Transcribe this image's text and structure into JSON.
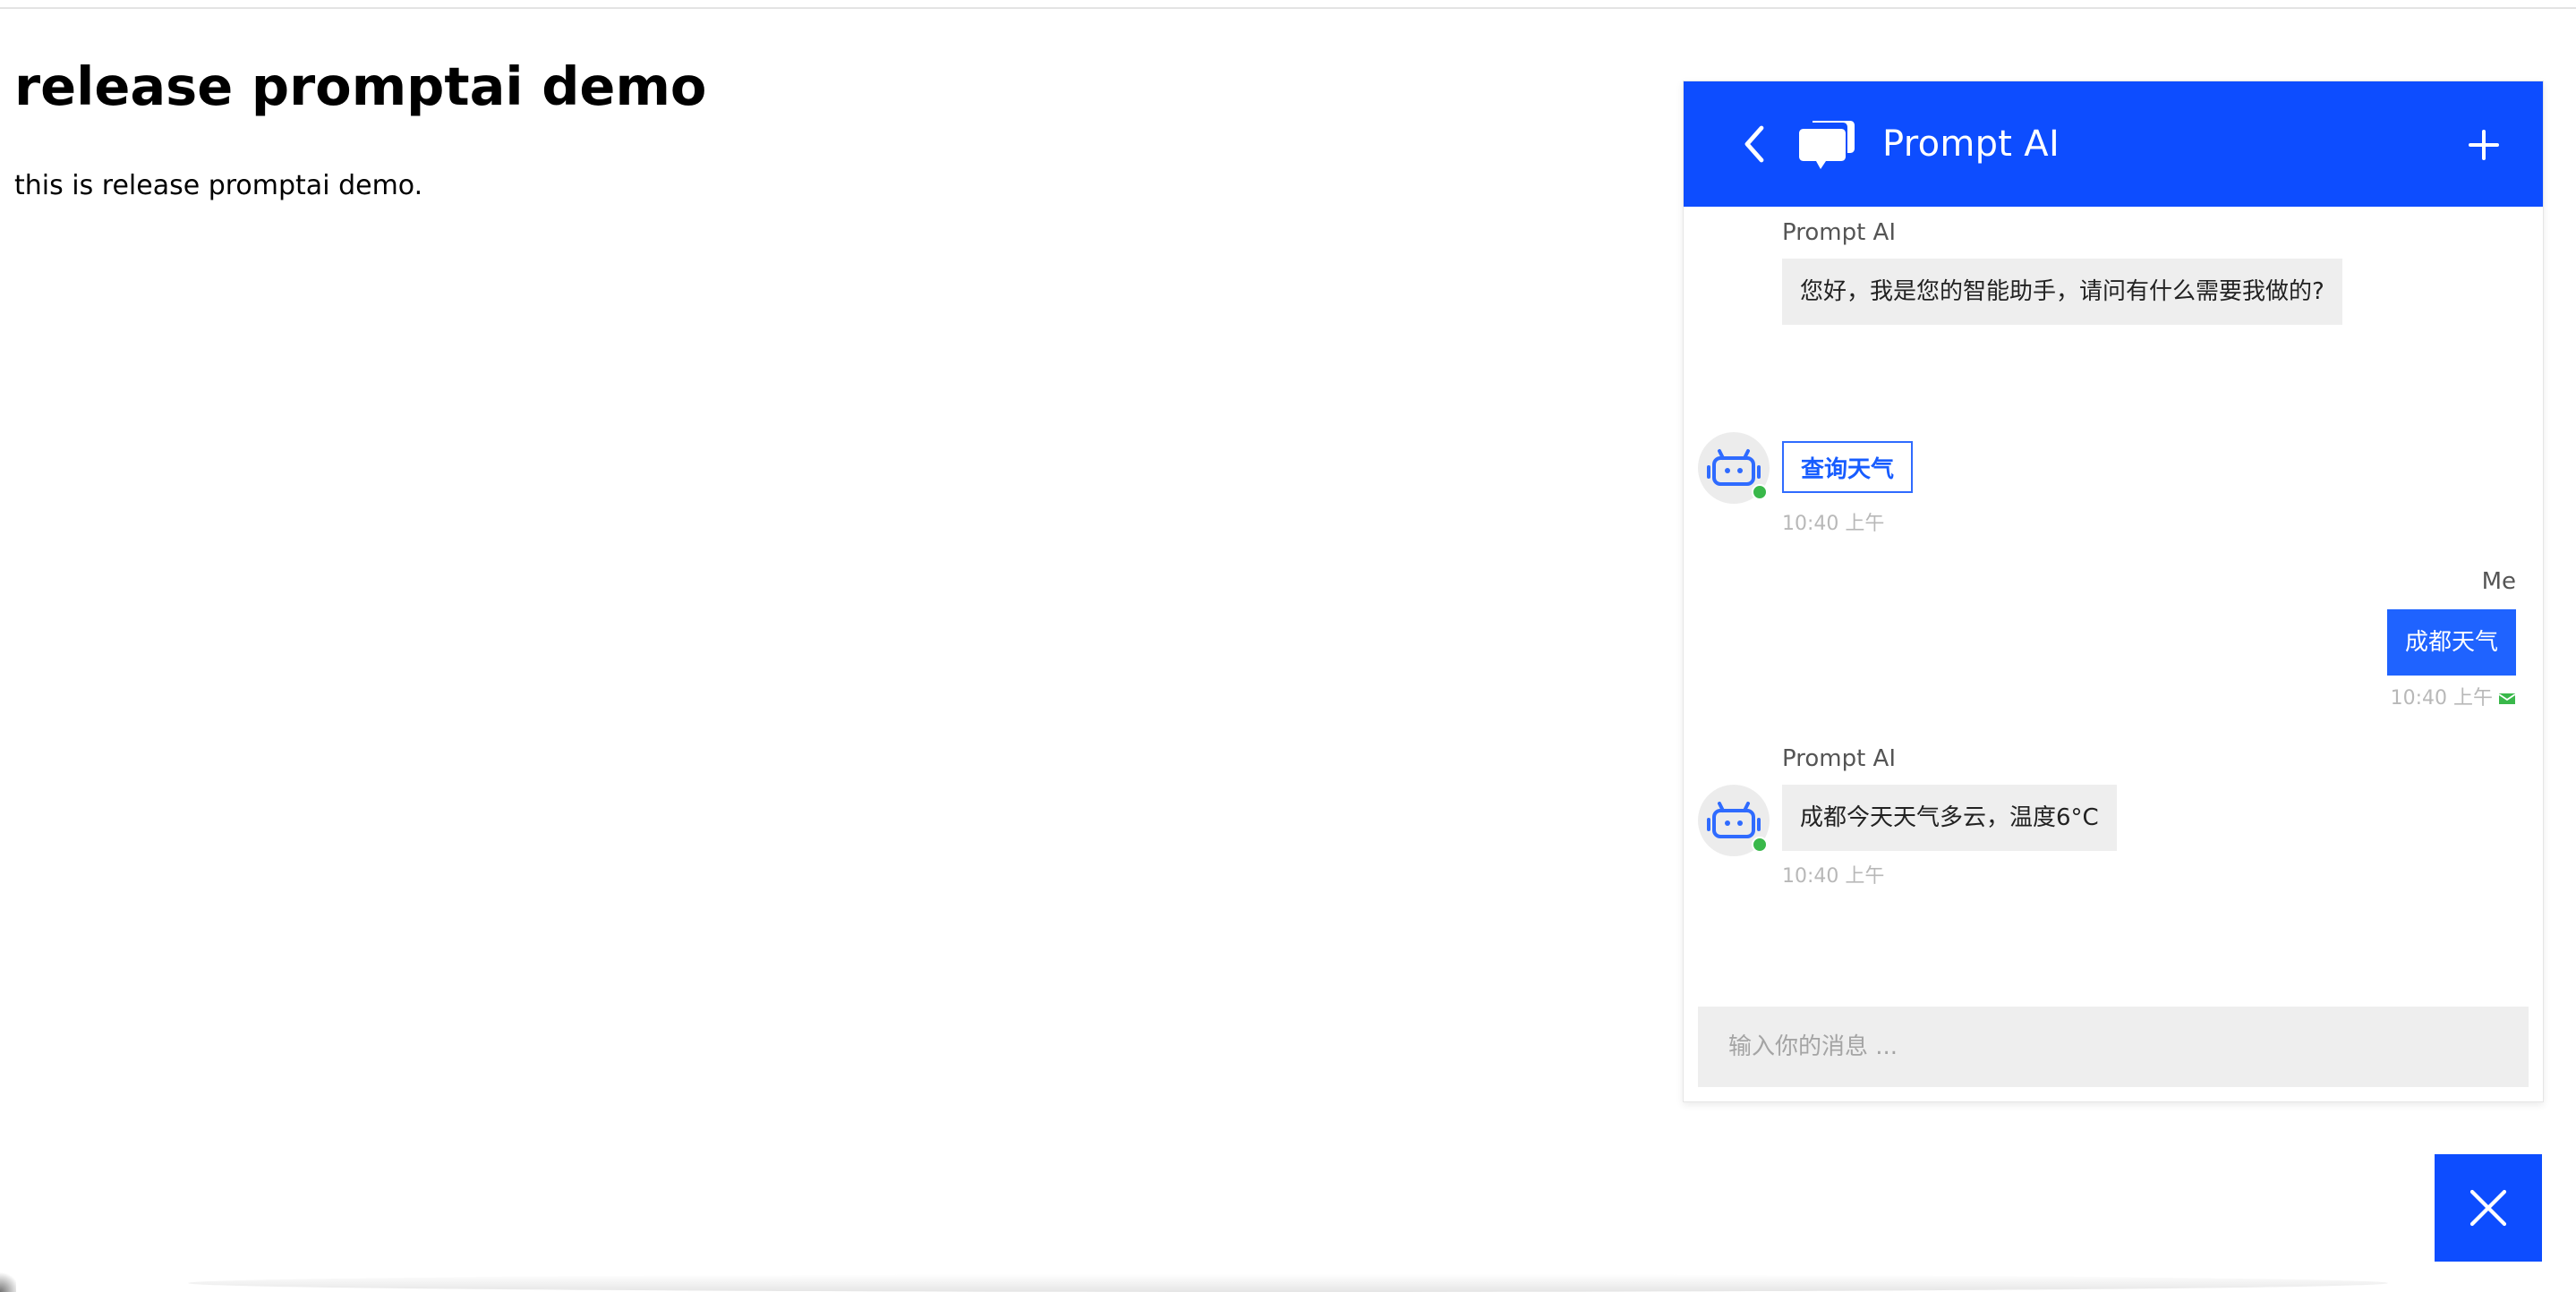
{
  "page": {
    "title": "release promptai demo",
    "description": "this is release promptai demo."
  },
  "chat": {
    "header": {
      "title": "Prompt AI",
      "back_icon": "chevron-left-icon",
      "logo_icon": "chat-bubbles-icon",
      "new_chat_icon": "plus-icon"
    },
    "messages": [
      {
        "sender": "Prompt AI",
        "text": "您好，我是您的智能助手，请问有什么需要我做的?",
        "quick_reply": "查询天气",
        "time": "10:40 上午"
      },
      {
        "sender": "Me",
        "text": "成都天气",
        "time": "10:40 上午",
        "status_icon": "mail-icon"
      },
      {
        "sender": "Prompt AI",
        "text": "成都今天天气多云，温度6°C",
        "time": "10:40 上午"
      }
    ],
    "input": {
      "placeholder": "输入你的消息 ...",
      "value": ""
    },
    "close_icon": "close-icon"
  },
  "colors": {
    "primary": "#0D4DFF",
    "user_bubble": "#1F63FF",
    "bot_bubble": "#EEEEEE",
    "online_status": "#39B84A"
  }
}
